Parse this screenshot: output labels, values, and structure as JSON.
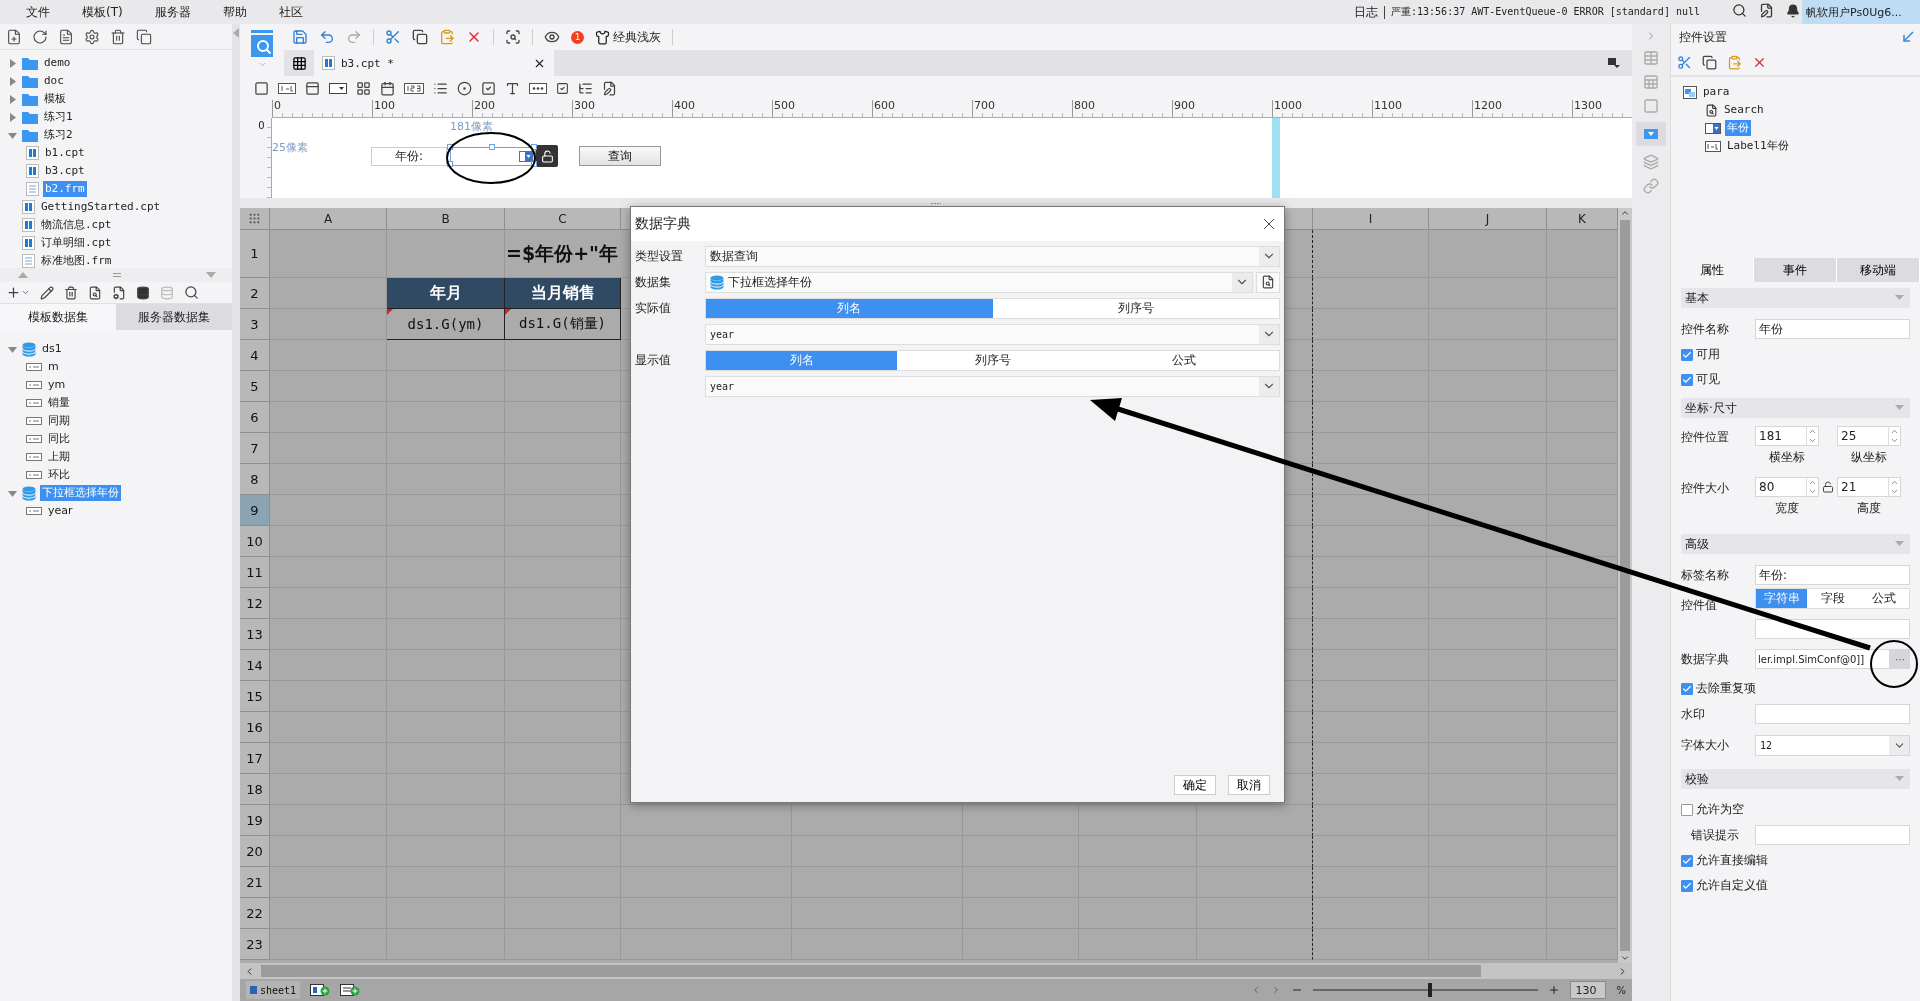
{
  "menu": [
    "文件",
    "模板(T)",
    "服务器",
    "帮助",
    "社区"
  ],
  "log_bar": {
    "label": "日志",
    "message": "严重:13:56:37 AWT-EventQueue-0 ERROR [standard] null"
  },
  "user": "帆软用户Ps0Ug6...",
  "file_tree": [
    {
      "label": "demo",
      "kind": "folder",
      "expanded": false,
      "selected": false
    },
    {
      "label": "doc",
      "kind": "folder",
      "expanded": false,
      "selected": false
    },
    {
      "label": "模板",
      "kind": "folder",
      "expanded": false,
      "selected": false
    },
    {
      "label": "练习1",
      "kind": "folder",
      "expanded": false,
      "selected": false
    },
    {
      "label": "练习2",
      "kind": "folder",
      "expanded": true,
      "selected": false,
      "children": [
        {
          "label": "b1.cpt",
          "kind": "report",
          "selected": false
        },
        {
          "label": "b3.cpt",
          "kind": "report",
          "selected": false
        },
        {
          "label": "b2.frm",
          "kind": "form",
          "selected": true
        }
      ]
    },
    {
      "label": "GettingStarted.cpt",
      "kind": "report",
      "selected": false
    },
    {
      "label": "物流信息.cpt",
      "kind": "report",
      "selected": false
    },
    {
      "label": "订单明细.cpt",
      "kind": "report",
      "selected": false
    },
    {
      "label": "标准地图.frm",
      "kind": "form",
      "selected": false
    }
  ],
  "dataset_tabs": [
    {
      "label": "模板数据集",
      "selected": true
    },
    {
      "label": "服务器数据集",
      "selected": false
    }
  ],
  "datasets": [
    {
      "label": "ds1",
      "kind": "dataset",
      "expanded": true,
      "selected": false,
      "children": [
        {
          "label": "m",
          "kind": "field",
          "selected": false
        },
        {
          "label": "ym",
          "kind": "field",
          "selected": false
        },
        {
          "label": "销量",
          "kind": "field",
          "selected": false
        },
        {
          "label": "同期",
          "kind": "field",
          "selected": false
        },
        {
          "label": "同比",
          "kind": "field",
          "selected": false
        },
        {
          "label": "上期",
          "kind": "field",
          "selected": false
        },
        {
          "label": "环比",
          "kind": "field",
          "selected": false
        }
      ]
    },
    {
      "label": "下拉框选择年份",
      "kind": "dataset",
      "expanded": true,
      "selected": true,
      "children": [
        {
          "label": "year",
          "kind": "field",
          "selected": false
        }
      ]
    }
  ],
  "toolbar": {
    "badge": "1",
    "theme": "经典浅灰"
  },
  "doc_tabs": [
    {
      "label": "b3.cpt *",
      "selected": true
    }
  ],
  "ruler": [
    "0",
    "100",
    "200",
    "300",
    "400",
    "500",
    "600",
    "700",
    "800",
    "900",
    "1000",
    "1100",
    "1200",
    "1300"
  ],
  "vertical_ruler": "0",
  "parameter_pane": {
    "x_hint": "181像素",
    "y_hint": "25像素",
    "label": "年份:",
    "query_button": "查询"
  },
  "sheet": {
    "columns_left": [
      "A",
      "B",
      "C"
    ],
    "columns_right": [
      "I",
      "J",
      "K"
    ],
    "rows": [
      {
        "number": "1",
        "selected": false,
        "cells": [
          {
            "kind": "blank"
          },
          {
            "kind": "blank"
          },
          {
            "kind": "title",
            "text": "=$年份+\"年"
          }
        ]
      },
      {
        "number": "2",
        "selected": false,
        "cells": [
          {
            "kind": "blank"
          },
          {
            "kind": "header",
            "text": "年月"
          },
          {
            "kind": "header",
            "text": "当月销售"
          }
        ]
      },
      {
        "number": "3",
        "selected": false,
        "cells": [
          {
            "kind": "blank"
          },
          {
            "kind": "data",
            "text": "ds1.G(ym)"
          },
          {
            "kind": "data",
            "text": "ds1.G(销量)"
          }
        ]
      },
      {
        "number": "4",
        "selected": false
      },
      {
        "number": "5",
        "selected": false
      },
      {
        "number": "6",
        "selected": false
      },
      {
        "number": "7",
        "selected": false
      },
      {
        "number": "8",
        "selected": false
      },
      {
        "number": "9",
        "selected": true
      },
      {
        "number": "10",
        "selected": false
      },
      {
        "number": "11",
        "selected": false
      },
      {
        "number": "12",
        "selected": false
      },
      {
        "number": "13",
        "selected": false
      },
      {
        "number": "14",
        "selected": false
      },
      {
        "number": "15",
        "selected": false
      },
      {
        "number": "16",
        "selected": false
      },
      {
        "number": "17",
        "selected": false
      },
      {
        "number": "18",
        "selected": false
      },
      {
        "number": "19",
        "selected": false
      },
      {
        "number": "20",
        "selected": false
      },
      {
        "number": "21",
        "selected": false
      },
      {
        "number": "22",
        "selected": false
      },
      {
        "number": "23",
        "selected": false
      }
    ]
  },
  "sheet_tabs": [
    {
      "label": "sheet1",
      "selected": true
    }
  ],
  "zoom": {
    "level": 0.52,
    "value": "130",
    "unit": "%"
  },
  "dialog": {
    "title": "数据字典",
    "rows": [
      {
        "kind": "select",
        "label": "类型设置",
        "value": "数据查询"
      },
      {
        "kind": "dataset",
        "label": "数据集",
        "value": "下拉框选择年份"
      },
      {
        "kind": "segmented",
        "label": "实际值",
        "options": [
          {
            "label": "列名",
            "selected": true
          },
          {
            "label": "列序号",
            "selected": false
          }
        ]
      },
      {
        "kind": "select",
        "value": "year"
      },
      {
        "kind": "segmented",
        "label": "显示值",
        "options": [
          {
            "label": "列名",
            "selected": true
          },
          {
            "label": "列序号",
            "selected": false
          },
          {
            "label": "公式",
            "selected": false
          }
        ]
      },
      {
        "kind": "select",
        "value": "year"
      }
    ],
    "buttons": [
      "确定",
      "取消"
    ]
  },
  "widget_panel": {
    "title": "控件设置",
    "tree": {
      "label": "para",
      "selected": false,
      "children": [
        {
          "label": "Search",
          "kind": "button",
          "selected": false
        },
        {
          "label": "年份",
          "kind": "combo",
          "selected": true
        },
        {
          "label": "Label1年份",
          "kind": "label",
          "selected": false
        }
      ]
    },
    "tabs": [
      {
        "label": "属性",
        "selected": true
      },
      {
        "label": "事件",
        "selected": false
      },
      {
        "label": "移动端",
        "selected": false
      }
    ],
    "sections": [
      {
        "title": "基本",
        "rows": [
          {
            "kind": "text",
            "label": "控件名称",
            "value": "年份"
          },
          {
            "kind": "checkbox",
            "label": "可用",
            "checked": true
          },
          {
            "kind": "checkbox",
            "label": "可见",
            "checked": true
          }
        ]
      },
      {
        "title": "坐标·尺寸",
        "rows": [
          {
            "kind": "spinners",
            "label": "控件位置",
            "fields": [
              {
                "value": "181",
                "caption": "横坐标"
              },
              {
                "value": "25",
                "caption": "纵坐标"
              }
            ]
          },
          {
            "kind": "spinners",
            "label": "控件大小",
            "locked": false,
            "fields": [
              {
                "value": "80",
                "caption": "宽度"
              },
              {
                "value": "21",
                "caption": "高度"
              }
            ]
          }
        ]
      },
      {
        "title": "高级",
        "rows": [
          {
            "kind": "text",
            "label": "标签名称",
            "value": "年份:"
          },
          {
            "kind": "segmented",
            "label": "控件值",
            "options": [
              {
                "label": "字符串",
                "selected": true
              },
              {
                "label": "字段",
                "selected": false
              },
              {
                "label": "公式",
                "selected": false
              }
            ]
          },
          {
            "kind": "text"
          },
          {
            "kind": "picker",
            "label": "数据字典",
            "value": "ler.impl.SimConf@0]]",
            "button": "···"
          },
          {
            "kind": "checkbox",
            "label": "去除重复项",
            "checked": true
          },
          {
            "kind": "text",
            "label": "水印"
          },
          {
            "kind": "select",
            "label": "字体大小",
            "value": "12"
          }
        ]
      },
      {
        "title": "校验",
        "rows": [
          {
            "kind": "checkbox",
            "label": "允许为空",
            "checked": false
          },
          {
            "kind": "text",
            "label": "错误提示",
            "indent": true
          },
          {
            "kind": "checkbox",
            "label": "允许直接编辑",
            "checked": true
          },
          {
            "kind": "checkbox",
            "label": "允许自定义值",
            "checked": true
          }
        ]
      }
    ]
  }
}
